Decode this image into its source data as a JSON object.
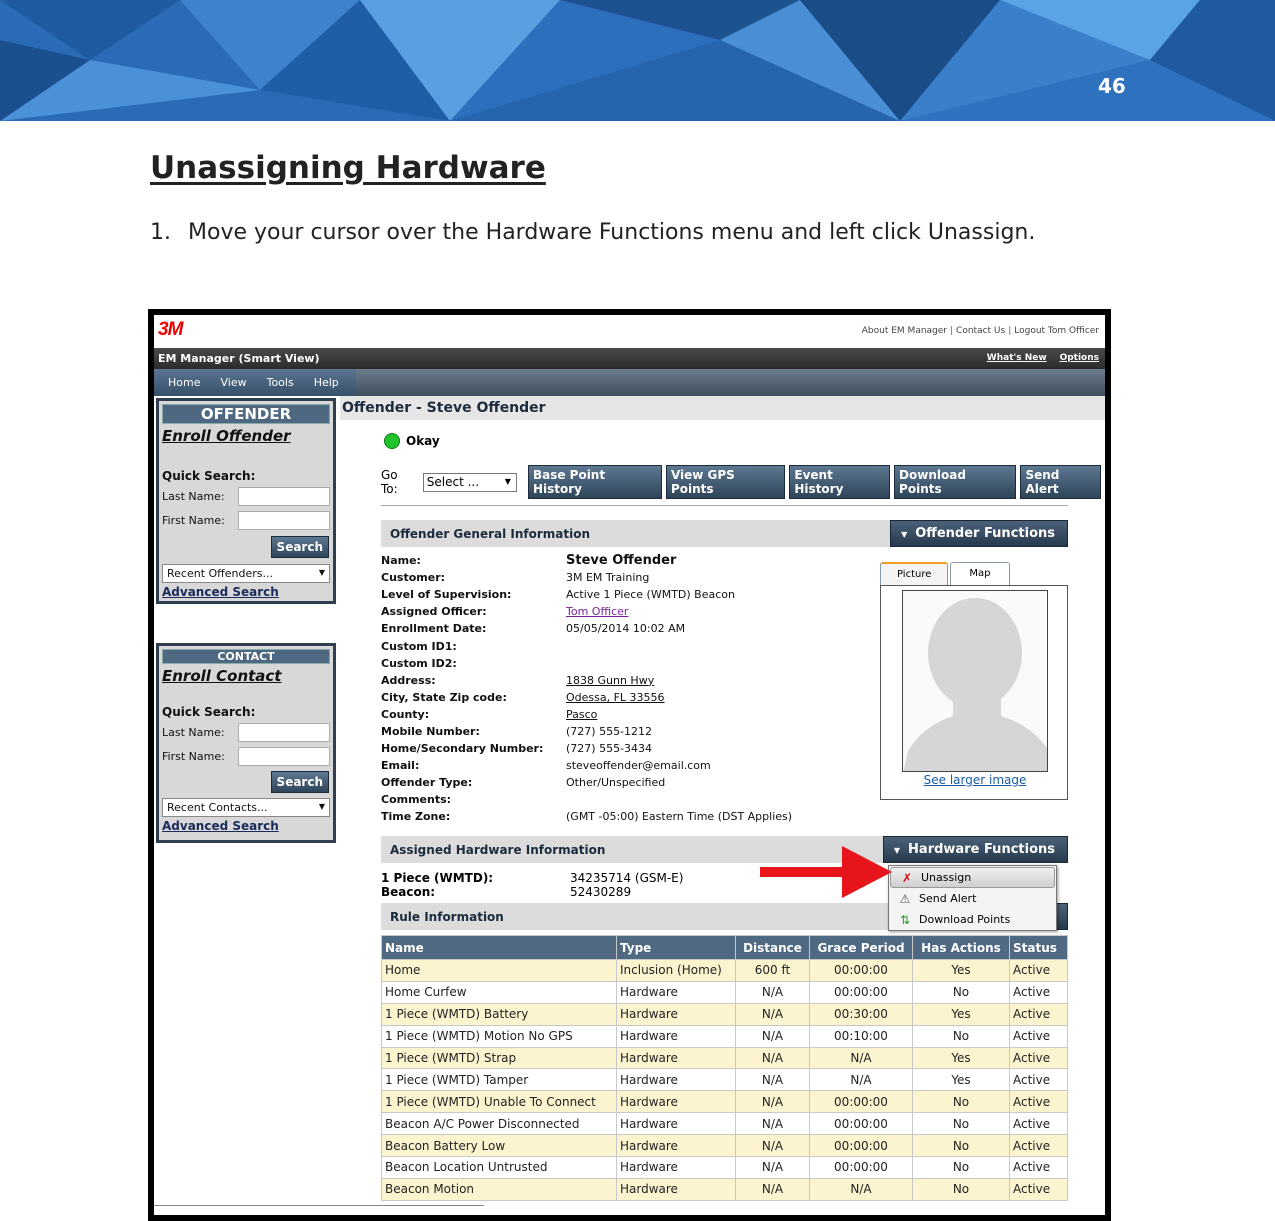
{
  "page": {
    "number": "46",
    "heading": "Unassigning Hardware",
    "step_number": "1.",
    "step_text": "Move your cursor over the Hardware Functions menu and left click Unassign."
  },
  "app": {
    "logo": "3M",
    "top_links": [
      "About EM Manager",
      "Contact Us",
      "Logout Tom Officer"
    ],
    "title": "EM Manager (Smart View)",
    "title_links": [
      "What's New",
      "Options"
    ],
    "menus": [
      "Home",
      "View",
      "Tools",
      "Help"
    ]
  },
  "offender_panel": {
    "header": "OFFENDER",
    "enroll": "Enroll Offender",
    "quick_search": "Quick Search:",
    "last_name": "Last Name:",
    "first_name": "First Name:",
    "search": "Search",
    "recent": "Recent Offenders...",
    "advanced": "Advanced Search"
  },
  "contact_panel": {
    "header": "CONTACT",
    "enroll": "Enroll Contact",
    "quick_search": "Quick Search:",
    "last_name": "Last Name:",
    "first_name": "First Name:",
    "search": "Search",
    "recent": "Recent Contacts...",
    "advanced": "Advanced Search"
  },
  "main": {
    "title": "Offender - Steve Offender",
    "status": "Okay",
    "goto_label": "Go To:",
    "goto_select": "Select ...",
    "actions": [
      "Base Point History",
      "View GPS Points",
      "Event History",
      "Download Points",
      "Send Alert"
    ],
    "general_title": "Offender General Information",
    "offender_functions": "Offender Functions",
    "fields": [
      {
        "k": "Name:",
        "v": "Steve Offender"
      },
      {
        "k": "Customer:",
        "v": "3M EM Training"
      },
      {
        "k": "Level of Supervision:",
        "v": "Active 1 Piece (WMTD) Beacon"
      },
      {
        "k": "Assigned Officer:",
        "v": "Tom Officer"
      },
      {
        "k": "Enrollment Date:",
        "v": "05/05/2014 10:02 AM"
      },
      {
        "k": "Custom ID1:",
        "v": ""
      },
      {
        "k": "Custom ID2:",
        "v": ""
      },
      {
        "k": "Address:",
        "v": "1838 Gunn Hwy"
      },
      {
        "k": "City, State Zip code:",
        "v": "Odessa, FL 33556"
      },
      {
        "k": "County:",
        "v": "Pasco"
      },
      {
        "k": "Mobile Number:",
        "v": "(727) 555-1212"
      },
      {
        "k": "Home/Secondary Number:",
        "v": "(727) 555-3434"
      },
      {
        "k": "Email:",
        "v": "steveoffender@email.com"
      },
      {
        "k": "Offender Type:",
        "v": "Other/Unspecified"
      },
      {
        "k": "Comments:",
        "v": ""
      },
      {
        "k": "Time Zone:",
        "v": "(GMT -05:00) Eastern Time (DST Applies)"
      }
    ],
    "picture_tab": "Picture",
    "map_tab": "Map",
    "see_larger": "See larger image",
    "hardware_title": "Assigned Hardware Information",
    "hardware_functions": "Hardware Functions",
    "hardware_label_1": "1 Piece (WMTD):",
    "hardware_label_2": "Beacon:",
    "hardware_value_1": "34235714 (GSM-E)",
    "hardware_value_2": "52430289",
    "hardware_menu": [
      "Unassign",
      "Send Alert",
      "Download Points"
    ],
    "rule_title": "Rule Information",
    "rule_columns": [
      "Name",
      "Type",
      "Distance",
      "Grace Period",
      "Has Actions",
      "Status"
    ],
    "rules": [
      [
        "Home",
        "Inclusion (Home)",
        "600 ft",
        "00:00:00",
        "Yes",
        "Active"
      ],
      [
        "Home Curfew",
        "Hardware",
        "N/A",
        "00:00:00",
        "No",
        "Active"
      ],
      [
        "1 Piece (WMTD) Battery",
        "Hardware",
        "N/A",
        "00:30:00",
        "Yes",
        "Active"
      ],
      [
        "1 Piece (WMTD) Motion No GPS",
        "Hardware",
        "N/A",
        "00:10:00",
        "No",
        "Active"
      ],
      [
        "1 Piece (WMTD) Strap",
        "Hardware",
        "N/A",
        "N/A",
        "Yes",
        "Active"
      ],
      [
        "1 Piece (WMTD) Tamper",
        "Hardware",
        "N/A",
        "N/A",
        "Yes",
        "Active"
      ],
      [
        "1 Piece (WMTD) Unable To Connect",
        "Hardware",
        "N/A",
        "00:00:00",
        "No",
        "Active"
      ],
      [
        "Beacon A/C Power Disconnected",
        "Hardware",
        "N/A",
        "00:00:00",
        "No",
        "Active"
      ],
      [
        "Beacon Battery Low",
        "Hardware",
        "N/A",
        "00:00:00",
        "No",
        "Active"
      ],
      [
        "Beacon Location Untrusted",
        "Hardware",
        "N/A",
        "00:00:00",
        "No",
        "Active"
      ],
      [
        "Beacon Motion",
        "Hardware",
        "N/A",
        "N/A",
        "No",
        "Active"
      ]
    ]
  },
  "colors": {
    "banner_blue": "#1f5fa8",
    "header_steel": "#4f6982",
    "odd_row": "#fbf4cf",
    "status_ok": "#22c22a",
    "callout_arrow": "#e8141c"
  }
}
